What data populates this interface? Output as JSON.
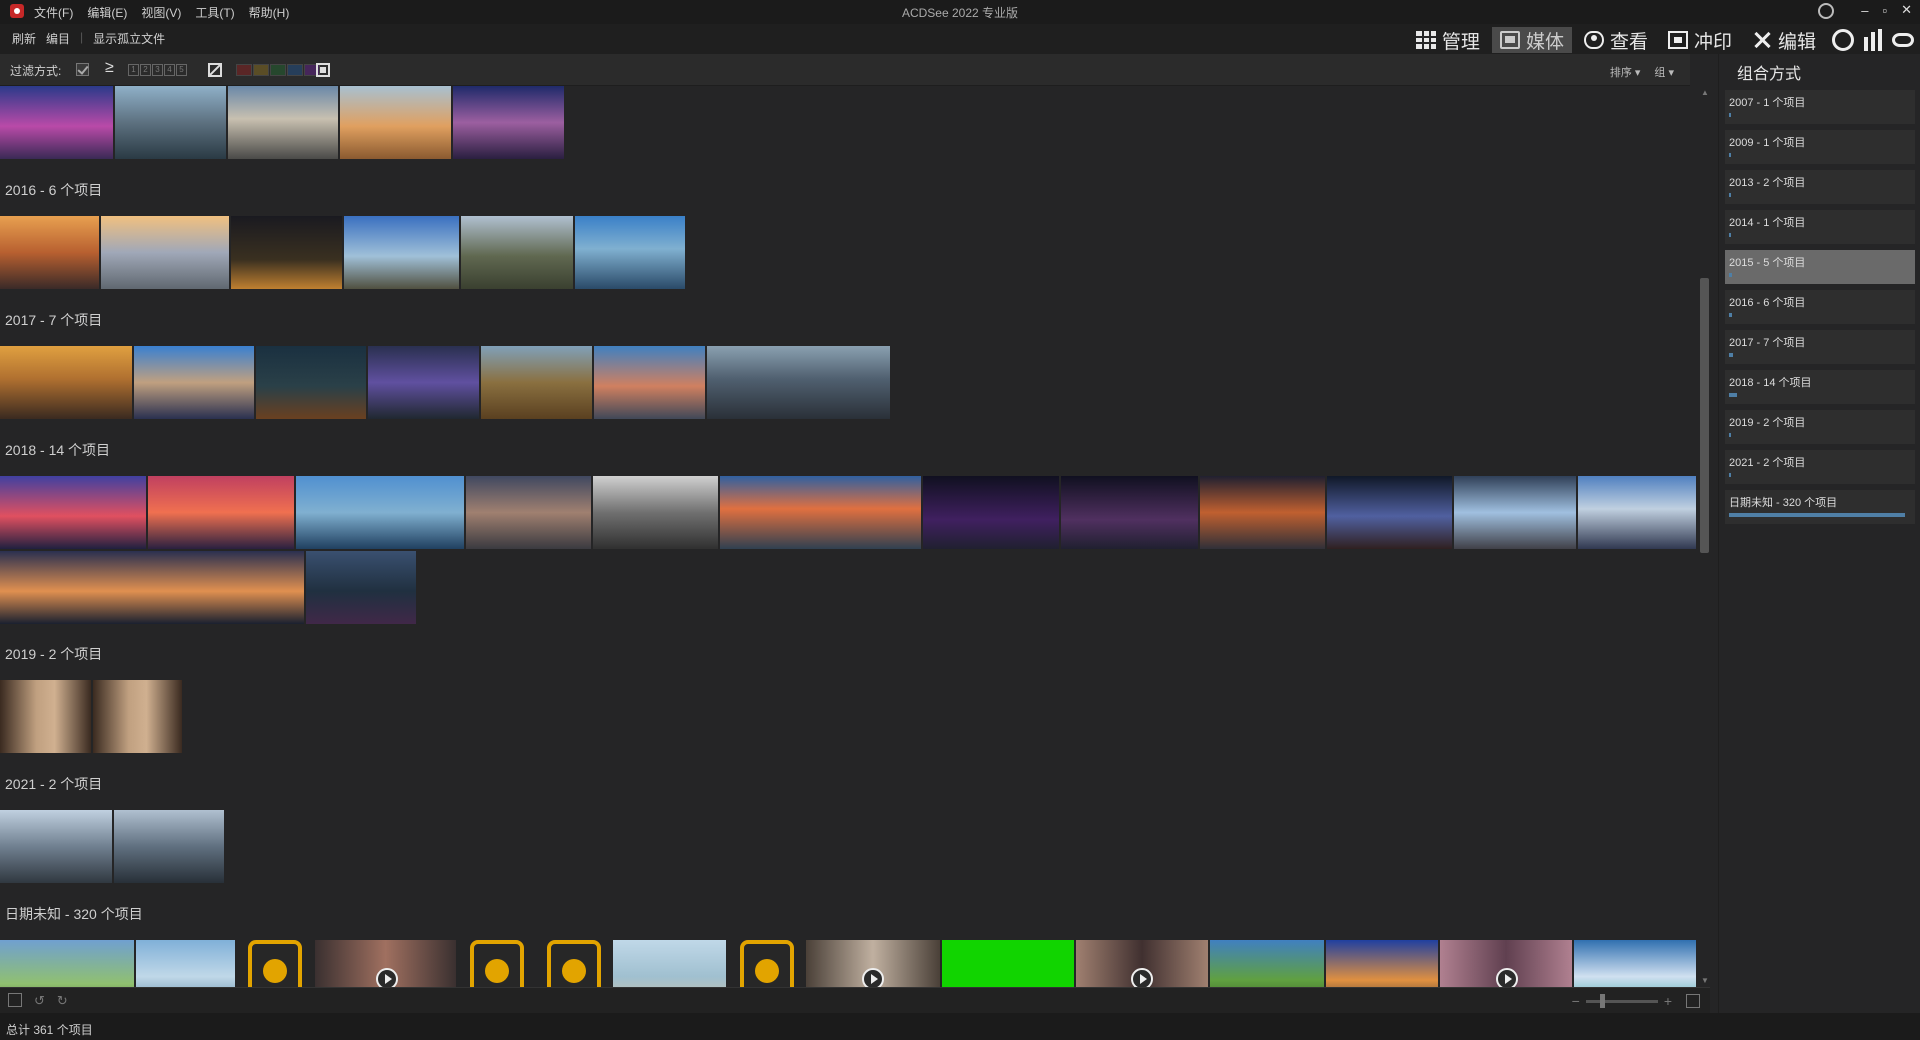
{
  "window": {
    "title": "ACDSee 2022 专业版",
    "controls": [
      "–",
      "▫",
      "✕"
    ]
  },
  "menus": [
    "文件(F)",
    "编辑(E)",
    "视图(V)",
    "工具(T)",
    "帮助(H)"
  ],
  "toolbar": {
    "refresh": "刷新",
    "catalog": "编目",
    "show_orphans": "显示孤立文件"
  },
  "modes": [
    {
      "label": "管理",
      "icon": "grid-icon",
      "active": false
    },
    {
      "label": "媒体",
      "icon": "media-icon",
      "active": true
    },
    {
      "label": "查看",
      "icon": "eye-icon",
      "active": false
    },
    {
      "label": "冲印",
      "icon": "develop-icon",
      "active": false
    },
    {
      "label": "编辑",
      "icon": "edit-tools-icon",
      "active": false
    }
  ],
  "filter": {
    "label": "过滤方式:",
    "operator": "≥",
    "ratings": [
      "1",
      "2",
      "3",
      "4",
      "5"
    ]
  },
  "sort": {
    "sort_label": "排序 ▾",
    "group_label": "组 ▾"
  },
  "groups": [
    {
      "label": "2016 - 6 个项目"
    },
    {
      "label": "2017 - 7 个项目"
    },
    {
      "label": "2018 - 14 个项目"
    },
    {
      "label": "2019 - 2 个项目"
    },
    {
      "label": "2021 - 2 个项目"
    },
    {
      "label": "日期未知 - 320 个项目"
    }
  ],
  "group_panel": {
    "title": "组合方式",
    "items": [
      {
        "label": "2007 - 1 个项目",
        "fraction": 0.003
      },
      {
        "label": "2009 - 1 个项目",
        "fraction": 0.003
      },
      {
        "label": "2013 - 2 个项目",
        "fraction": 0.006
      },
      {
        "label": "2014 - 1 个项目",
        "fraction": 0.003
      },
      {
        "label": "2015 - 5 个项目",
        "fraction": 0.016,
        "selected": true
      },
      {
        "label": "2016 - 6 个项目",
        "fraction": 0.019
      },
      {
        "label": "2017 - 7 个项目",
        "fraction": 0.022
      },
      {
        "label": "2018 - 14 个项目",
        "fraction": 0.044
      },
      {
        "label": "2019 - 2 个项目",
        "fraction": 0.006
      },
      {
        "label": "2021 - 2 个项目",
        "fraction": 0.006
      },
      {
        "label": "日期未知 - 320 个项目",
        "fraction": 1.0
      }
    ]
  },
  "status": {
    "total": "总计 361 个项目"
  },
  "colors": {
    "accent_bar": "#4f7fa6",
    "video_badge": "#e2a400",
    "selected_group": "#6a6a6a"
  }
}
